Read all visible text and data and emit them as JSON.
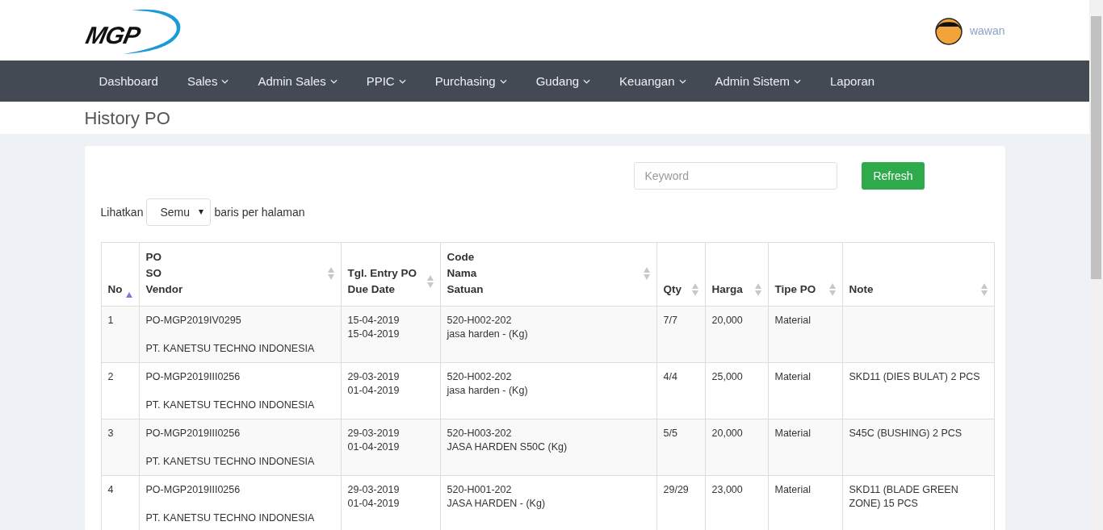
{
  "header": {
    "logo": "MGP",
    "user": {
      "name": "wawan"
    }
  },
  "nav": [
    {
      "label": "Dashboard",
      "dropdown": false
    },
    {
      "label": "Sales",
      "dropdown": true
    },
    {
      "label": "Admin Sales",
      "dropdown": true
    },
    {
      "label": "PPIC",
      "dropdown": true
    },
    {
      "label": "Purchasing",
      "dropdown": true
    },
    {
      "label": "Gudang",
      "dropdown": true
    },
    {
      "label": "Keuangan",
      "dropdown": true
    },
    {
      "label": "Admin Sistem",
      "dropdown": true
    },
    {
      "label": "Laporan",
      "dropdown": false
    }
  ],
  "page_title": "History PO",
  "search": {
    "placeholder": "Keyword"
  },
  "refresh_button": "Refresh",
  "length_control": {
    "before": "Lihatkan",
    "value": "Semu",
    "after": "baris per halaman"
  },
  "table": {
    "columns": [
      {
        "lines": [
          "No"
        ],
        "sorted_ascending": true
      },
      {
        "lines": [
          "PO",
          "SO",
          "Vendor"
        ],
        "sorted_ascending": false
      },
      {
        "lines": [
          "Tgl. Entry PO",
          "Due Date"
        ],
        "sorted_ascending": false
      },
      {
        "lines": [
          "Code",
          "Nama",
          "Satuan"
        ],
        "sorted_ascending": false
      },
      {
        "lines": [
          "Qty"
        ],
        "sorted_ascending": false
      },
      {
        "lines": [
          "Harga"
        ],
        "sorted_ascending": false
      },
      {
        "lines": [
          "Tipe PO"
        ],
        "sorted_ascending": false
      },
      {
        "lines": [
          "Note"
        ],
        "sorted_ascending": false
      }
    ],
    "rows": [
      {
        "no": "1",
        "po": "PO-MGP2019IV0295",
        "vendor": "PT. KANETSU TECHNO INDONESIA",
        "entry_date": "15-04-2019",
        "due_date": "15-04-2019",
        "code": "520-H002-202",
        "name": "jasa harden - (Kg)",
        "qty": "7/7",
        "price": "20,000",
        "type": "Material"
      },
      {
        "no": "2",
        "po": "PO-MGP2019III0256",
        "vendor": "PT. KANETSU TECHNO INDONESIA",
        "entry_date": "29-03-2019",
        "due_date": "01-04-2019",
        "code": "520-H002-202",
        "name": "jasa harden - (Kg)",
        "qty": "4/4",
        "price": "25,000",
        "type": "Material",
        "note": "SKD11 (DIES BULAT) 2 PCS"
      },
      {
        "no": "3",
        "po": "PO-MGP2019III0256",
        "vendor": "PT. KANETSU TECHNO INDONESIA",
        "entry_date": "29-03-2019",
        "due_date": "01-04-2019",
        "code": "520-H003-202",
        "name": "JASA HARDEN S50C (Kg)",
        "qty": "5/5",
        "price": "20,000",
        "type": "Material",
        "note": "S45C (BUSHING) 2 PCS"
      },
      {
        "no": "4",
        "po": "PO-MGP2019III0256",
        "vendor": "PT. KANETSU TECHNO INDONESIA",
        "entry_date": "29-03-2019",
        "due_date": "01-04-2019",
        "code": "520-H001-202",
        "name": "JASA HARDEN - (Kg)",
        "qty": "29/29",
        "price": "23,000",
        "type": "Material",
        "note": "SKD11 (BLADE GREEN ZONE) 15 PCS"
      }
    ]
  }
}
